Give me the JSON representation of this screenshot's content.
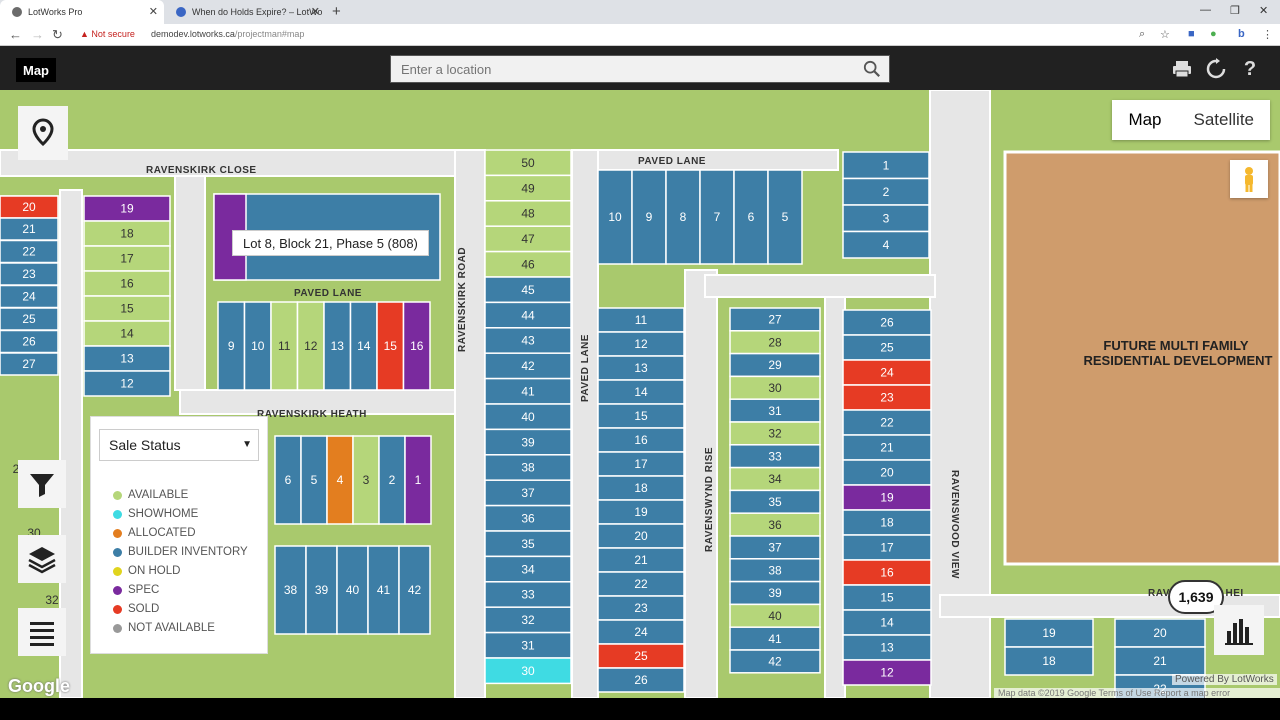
{
  "browser": {
    "tabs": [
      {
        "title": "LotWorks Pro",
        "active": true
      },
      {
        "title": "When do Holds Expire? – LotWo",
        "active": false
      }
    ],
    "not_secure": "Not secure",
    "url_host": "demodev.lotworks.ca",
    "url_path": "/projectman#map"
  },
  "header": {
    "map_label": "Map",
    "search_placeholder": "Enter a location",
    "icons": [
      "print-icon",
      "refresh-icon",
      "help-icon"
    ]
  },
  "map": {
    "map_type": {
      "map": "Map",
      "satellite": "Satellite"
    },
    "tooltip": "Lot 8, Block 21, Phase 5 (808)",
    "development_label_1": "FUTURE MULTI FAMILY",
    "development_label_2": "RESIDENTIAL DEVELOPMENT",
    "count_badge": "1,639",
    "google": "Google",
    "powered": "Powered By LotWorks",
    "attribution": "Map data ©2019 Google   Terms of Use   Report a map error",
    "streets": {
      "ravenskirk_close": "RAVENSKIRK CLOSE",
      "paved_lane_a": "PAVED LANE",
      "paved_lane_b": "PAVED LANE",
      "paved_lane_c": "PAVED LANE",
      "ravenskirk_heath": "RAVENSKIRK HEATH",
      "ravenskirk_road": "RAVENSKIRK ROAD",
      "ravenswynd_rise": "RAVENSWYND RISE",
      "ravenswood_view": "RAVENSWOOD VIEW",
      "bottom_street_right": "RAVENSLOCH HEI"
    }
  },
  "legend": {
    "select": "Sale Status",
    "items": [
      {
        "label": "AVAILABLE",
        "color": "#a8cf6a"
      },
      {
        "label": "SHOWHOME",
        "color": "#33d6e0"
      },
      {
        "label": "ALLOCATED",
        "color": "#e07b1e"
      },
      {
        "label": "BUILDER INVENTORY",
        "color": "#2f73a0"
      },
      {
        "label": "ON HOLD",
        "color": "#e0d41e"
      },
      {
        "label": "SPEC",
        "color": "#6a1fa0"
      },
      {
        "label": "SOLD",
        "color": "#e8231a"
      },
      {
        "label": "NOT AVAILABLE",
        "color": "#999999"
      }
    ]
  },
  "status_colors": {
    "A": "#b5d67a",
    "B": "#3d7ea6",
    "P": "#7a2a9e",
    "S": "#e63b24",
    "O": "#e37e1f",
    "H": "#3fdbe3"
  },
  "blocks": {
    "left_col_a": [
      [
        "20",
        "S"
      ],
      [
        "21",
        "B"
      ],
      [
        "22",
        "B"
      ],
      [
        "23",
        "B"
      ],
      [
        "24",
        "B"
      ],
      [
        "25",
        "B"
      ],
      [
        "26",
        "B"
      ],
      [
        "27",
        "B"
      ]
    ],
    "left_col_b": [
      [
        "19",
        "P"
      ],
      [
        "18",
        "A"
      ],
      [
        "17",
        "A"
      ],
      [
        "16",
        "A"
      ],
      [
        "15",
        "A"
      ],
      [
        "14",
        "A"
      ],
      [
        "13",
        "B"
      ],
      [
        "12",
        "B"
      ]
    ],
    "top_row_lots": [
      [
        "9",
        "B"
      ],
      [
        "10",
        "B"
      ],
      [
        "11",
        "A"
      ],
      [
        "12",
        "A"
      ],
      [
        "13",
        "B"
      ],
      [
        "14",
        "B"
      ],
      [
        "15",
        "S"
      ],
      [
        "16",
        "P"
      ]
    ],
    "heath_row": [
      [
        "6",
        "B"
      ],
      [
        "5",
        "B"
      ],
      [
        "4",
        "O"
      ],
      [
        "3",
        "A"
      ],
      [
        "2",
        "B"
      ],
      [
        "1",
        "P"
      ]
    ],
    "heath_bottom": [
      [
        "38",
        "B"
      ],
      [
        "39",
        "B"
      ],
      [
        "40",
        "B"
      ],
      [
        "41",
        "B"
      ],
      [
        "42",
        "B"
      ]
    ],
    "center_col": [
      [
        "50",
        "A"
      ],
      [
        "49",
        "A"
      ],
      [
        "48",
        "A"
      ],
      [
        "47",
        "A"
      ],
      [
        "46",
        "A"
      ],
      [
        "45",
        "B"
      ],
      [
        "44",
        "B"
      ],
      [
        "43",
        "B"
      ],
      [
        "42",
        "B"
      ],
      [
        "41",
        "B"
      ],
      [
        "40",
        "B"
      ],
      [
        "39",
        "B"
      ],
      [
        "38",
        "B"
      ],
      [
        "37",
        "B"
      ],
      [
        "36",
        "B"
      ],
      [
        "35",
        "B"
      ],
      [
        "34",
        "B"
      ],
      [
        "33",
        "B"
      ],
      [
        "32",
        "B"
      ],
      [
        "31",
        "B"
      ],
      [
        "30",
        "H"
      ]
    ],
    "paved_lane_top": [
      [
        "10",
        "B"
      ],
      [
        "9",
        "B"
      ],
      [
        "8",
        "B"
      ],
      [
        "7",
        "B"
      ],
      [
        "6",
        "B"
      ],
      [
        "5",
        "B"
      ]
    ],
    "lane_col": [
      [
        "11",
        "B"
      ],
      [
        "12",
        "B"
      ],
      [
        "13",
        "B"
      ],
      [
        "14",
        "B"
      ],
      [
        "15",
        "B"
      ],
      [
        "16",
        "B"
      ],
      [
        "17",
        "B"
      ],
      [
        "18",
        "B"
      ],
      [
        "19",
        "B"
      ],
      [
        "20",
        "B"
      ],
      [
        "21",
        "B"
      ],
      [
        "22",
        "B"
      ],
      [
        "23",
        "B"
      ],
      [
        "24",
        "B"
      ],
      [
        "25",
        "S"
      ],
      [
        "26",
        "B"
      ]
    ],
    "rise_col": [
      [
        "27",
        "B"
      ],
      [
        "28",
        "A"
      ],
      [
        "29",
        "B"
      ],
      [
        "30",
        "A"
      ],
      [
        "31",
        "B"
      ],
      [
        "32",
        "A"
      ],
      [
        "33",
        "B"
      ],
      [
        "34",
        "A"
      ],
      [
        "35",
        "B"
      ],
      [
        "36",
        "A"
      ],
      [
        "37",
        "B"
      ],
      [
        "38",
        "B"
      ],
      [
        "39",
        "B"
      ],
      [
        "40",
        "A"
      ],
      [
        "41",
        "B"
      ],
      [
        "42",
        "B"
      ]
    ],
    "right_top": [
      [
        "1",
        "B"
      ],
      [
        "2",
        "B"
      ],
      [
        "3",
        "B"
      ],
      [
        "4",
        "B"
      ]
    ],
    "right_col": [
      [
        "26",
        "B"
      ],
      [
        "25",
        "B"
      ],
      [
        "24",
        "S"
      ],
      [
        "23",
        "S"
      ],
      [
        "22",
        "B"
      ],
      [
        "21",
        "B"
      ],
      [
        "20",
        "B"
      ],
      [
        "19",
        "P"
      ],
      [
        "18",
        "B"
      ],
      [
        "17",
        "B"
      ],
      [
        "16",
        "S"
      ],
      [
        "15",
        "B"
      ],
      [
        "14",
        "B"
      ],
      [
        "13",
        "B"
      ],
      [
        "12",
        "P"
      ]
    ],
    "far_right_a": [
      [
        "19",
        "B"
      ],
      [
        "18",
        "B"
      ]
    ],
    "far_right_b": [
      [
        "20",
        "B"
      ],
      [
        "21",
        "B"
      ],
      [
        "22",
        "B"
      ]
    ],
    "misc_labels": [
      "30",
      "32",
      "2"
    ]
  }
}
